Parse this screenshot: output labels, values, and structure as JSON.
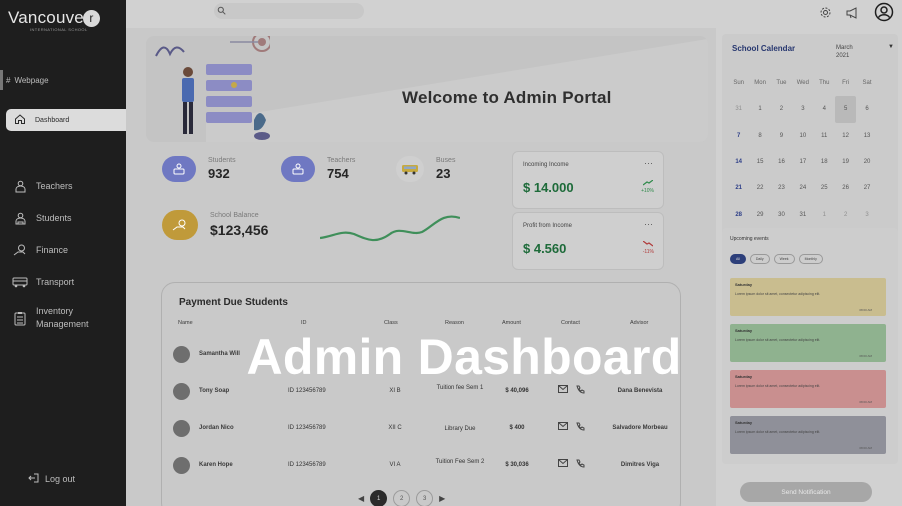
{
  "colors": {
    "sidebar_bg": "#1e1e1e",
    "main_bg": "#c9c9c9",
    "income_green": "#1e6b3a",
    "calendar_blue": "#283870"
  },
  "logo": {
    "name": "Vancouve",
    "badge": "r",
    "subtitle": "INTERNATIONAL SCHOOL"
  },
  "sidebar": {
    "webpage": "Webpage",
    "dashboard": "Dashboard",
    "items": [
      {
        "label": "Teachers",
        "icon": "teacher-icon"
      },
      {
        "label": "Students",
        "icon": "student-icon"
      },
      {
        "label": "Finance",
        "icon": "finance-icon"
      },
      {
        "label": "Transport",
        "icon": "bus-icon"
      },
      {
        "label": "Inventory Management",
        "icon": "clipboard-icon"
      }
    ],
    "logout": "Log out"
  },
  "banner": {
    "title": "Welcome to Admin Portal"
  },
  "stats": {
    "students": {
      "label": "Students",
      "value": "932"
    },
    "teachers": {
      "label": "Teachers",
      "value": "754"
    },
    "buses": {
      "label": "Buses",
      "value": "23"
    },
    "balance": {
      "label": "School Balance",
      "value": "$123,456"
    }
  },
  "income": {
    "incoming": {
      "label": "Incoming Income",
      "value": "$ 14.000",
      "trend": "+10%"
    },
    "profit": {
      "label": "Profit from Income",
      "value": "$ 4.560",
      "trend": "-11%"
    }
  },
  "payments": {
    "title": "Payment Due Students",
    "columns": [
      "Name",
      "ID",
      "Class",
      "Reason",
      "Amount",
      "Contact",
      "Advisor"
    ],
    "rows": [
      {
        "name": "Samantha Will",
        "id": "",
        "class": "",
        "reason": "",
        "amount": "",
        "advisor": ""
      },
      {
        "name": "Tony Soap",
        "id": "ID 123456789",
        "class": "XI B",
        "reason": "Tuition fee Sem 1",
        "amount": "$ 40,096",
        "advisor": "Dana Benevista"
      },
      {
        "name": "Jordan Nico",
        "id": "ID 123456789",
        "class": "XII C",
        "reason": "Library Due",
        "amount": "$ 400",
        "advisor": "Salvadore Morbeau"
      },
      {
        "name": "Karen Hope",
        "id": "ID 123456789",
        "class": "VI A",
        "reason": "Tuition Fee Sem 2",
        "amount": "$ 30,036",
        "advisor": "Dimitres Viga"
      }
    ],
    "pages": [
      "1",
      "2",
      "3"
    ]
  },
  "calendar": {
    "title": "School Calendar",
    "month": "March",
    "year": "2021",
    "weekdays": [
      "Sun",
      "Mon",
      "Tue",
      "Wed",
      "Thu",
      "Fri",
      "Sat"
    ],
    "days": [
      "31",
      "1",
      "2",
      "3",
      "4",
      "5",
      "6",
      "7",
      "8",
      "9",
      "10",
      "11",
      "12",
      "13",
      "14",
      "15",
      "16",
      "17",
      "18",
      "19",
      "20",
      "21",
      "22",
      "23",
      "24",
      "25",
      "26",
      "27",
      "28",
      "29",
      "30",
      "31",
      "1",
      "2",
      "3"
    ]
  },
  "events": {
    "title": "Upcoming events",
    "filters": [
      "All",
      "Daily",
      "Week",
      "Monthly"
    ],
    "items": [
      {
        "day": "Saturday",
        "text": "Lorem ipsum dolor sit amet, consectetur adipiscing elit.",
        "time": "08:00 AM",
        "color": "#c9bd8f"
      },
      {
        "day": "Saturday",
        "text": "Lorem ipsum dolor sit amet, consectetur adipiscing elit.",
        "time": "08:00 AM",
        "color": "#8fb28f"
      },
      {
        "day": "Saturday",
        "text": "Lorem ipsum dolor sit amet, consectetur adipiscing elit.",
        "time": "08:00 AM",
        "color": "#c98f8f"
      },
      {
        "day": "Saturday",
        "text": "Lorem ipsum dolor sit amet, consectetur adipiscing elit.",
        "time": "08:00 AM",
        "color": "#8f9099"
      }
    ]
  },
  "send_button": "Send Notification",
  "overlay_title": "Admin Dashboard"
}
